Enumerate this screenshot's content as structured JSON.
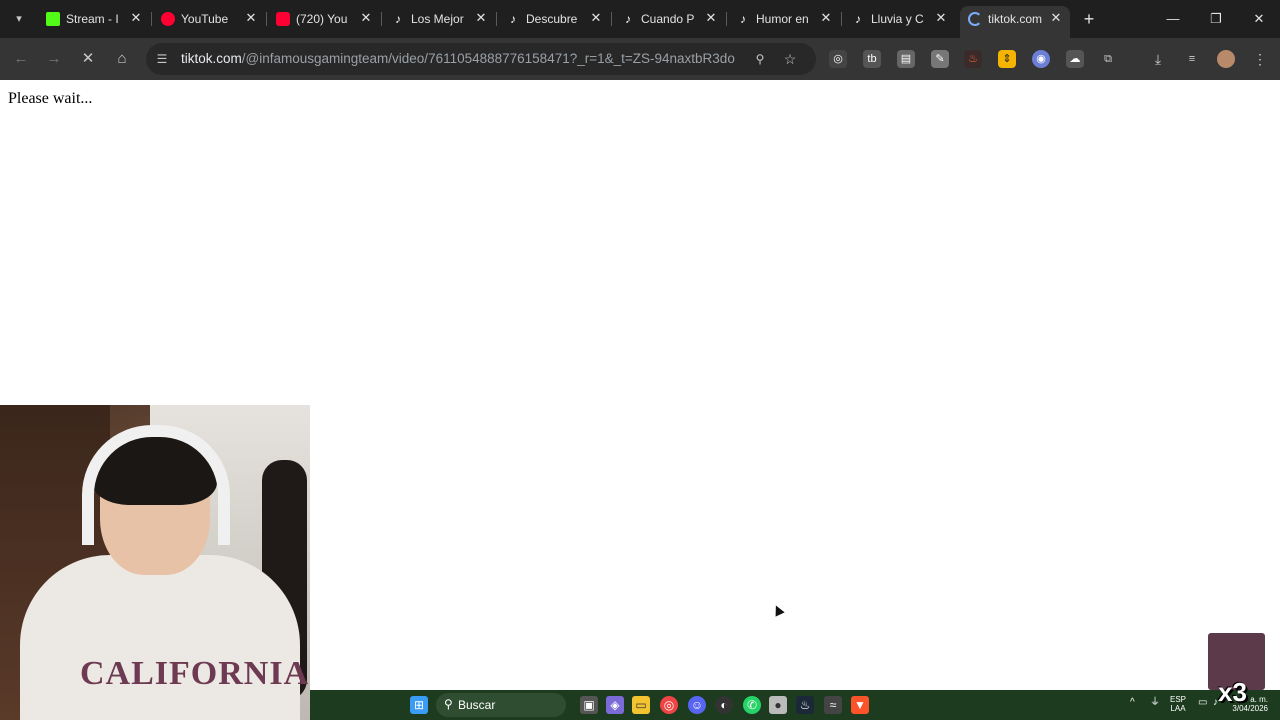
{
  "tabs": [
    {
      "title": "Stream - I",
      "icon": "kick-icon",
      "color": "#53fc18"
    },
    {
      "title": "YouTube",
      "icon": "youtube-icon",
      "color": "#ff0033"
    },
    {
      "title": "(720) You",
      "icon": "youtube-icon",
      "color": "#ff0033"
    },
    {
      "title": "Los Mejor",
      "icon": "tiktok-icon",
      "color": "#ffffff"
    },
    {
      "title": "Descubre",
      "icon": "tiktok-icon",
      "color": "#ffffff"
    },
    {
      "title": "Cuando P",
      "icon": "tiktok-icon",
      "color": "#ffffff"
    },
    {
      "title": "Humor en",
      "icon": "tiktok-icon",
      "color": "#ffffff"
    },
    {
      "title": "Lluvia y C",
      "icon": "tiktok-icon",
      "color": "#ffffff"
    },
    {
      "title": "tiktok.com",
      "icon": "loading-spinner-icon",
      "color": "#7cacf8",
      "active": true
    }
  ],
  "address_bar": {
    "host": "tiktok.com",
    "path": "/@infamousgamingteam/video/7611054888776158471?_r=1&_t=ZS-94naxtbR3do"
  },
  "page": {
    "message": "Please wait..."
  },
  "taskbar": {
    "search_label": "Buscar",
    "language_top": "ESP",
    "language_bottom": "LAA",
    "time": "a. m.",
    "date": "3/04/2026"
  },
  "webcam": {
    "sweater_text": "CALIFORNIA"
  },
  "overlay": {
    "multiplier": "x3"
  },
  "colors": {
    "tabstrip": "#1f1f1f",
    "toolbar": "#353535",
    "omnibox": "#282828",
    "taskbar": "#1c3b1f"
  }
}
